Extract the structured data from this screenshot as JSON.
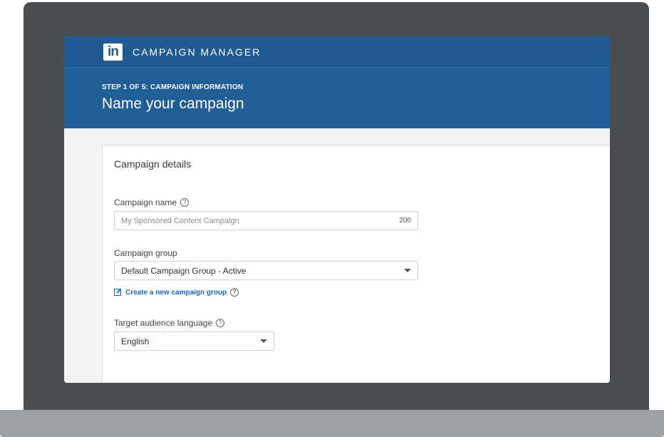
{
  "app": {
    "title": "CAMPAIGN MANAGER",
    "logo_text": "in"
  },
  "step": {
    "label": "STEP 1 OF 5: CAMPAIGN INFORMATION",
    "title": "Name your campaign"
  },
  "card": {
    "title": "Campaign details"
  },
  "campaign_name": {
    "label": "Campaign name",
    "placeholder": "My Sponsored Content Campaign",
    "char_count": "200"
  },
  "campaign_group": {
    "label": "Campaign group",
    "selected": "Default Campaign Group - Active",
    "create_link": "Create a new campaign group"
  },
  "audience_language": {
    "label": "Target audience language",
    "selected": "English"
  },
  "icons": {
    "help": "?"
  }
}
